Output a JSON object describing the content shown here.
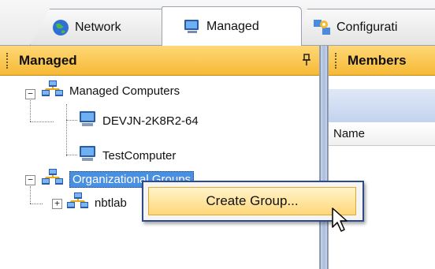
{
  "tabs": [
    {
      "label": "Network",
      "icon": "globe-icon"
    },
    {
      "label": "Managed",
      "icon": "monitor-icon",
      "active": true
    },
    {
      "label": "Configurati",
      "icon": "configuration-icon"
    }
  ],
  "left_panel": {
    "title": "Managed",
    "pin_glyph": "y",
    "tree": [
      {
        "label": "Managed Computers",
        "icon": "network-group-icon",
        "expander": "−"
      },
      {
        "label": "DEVJN-2K8R2-64",
        "icon": "computer-icon"
      },
      {
        "label": "TestComputer",
        "icon": "computer-icon"
      },
      {
        "label": "Organizational Groups",
        "icon": "network-group-icon",
        "expander": "−",
        "selected": true
      },
      {
        "label": "nbtlab",
        "icon": "network-group-icon",
        "expander": "+"
      }
    ]
  },
  "right_panel": {
    "title": "Members",
    "column_header": "Name"
  },
  "context_menu": {
    "items": [
      {
        "label": "Create Group..."
      }
    ]
  },
  "colors": {
    "header_gold": "#f6b936",
    "selection_blue": "#4a90e0",
    "menu_border": "#2f4a8a"
  }
}
